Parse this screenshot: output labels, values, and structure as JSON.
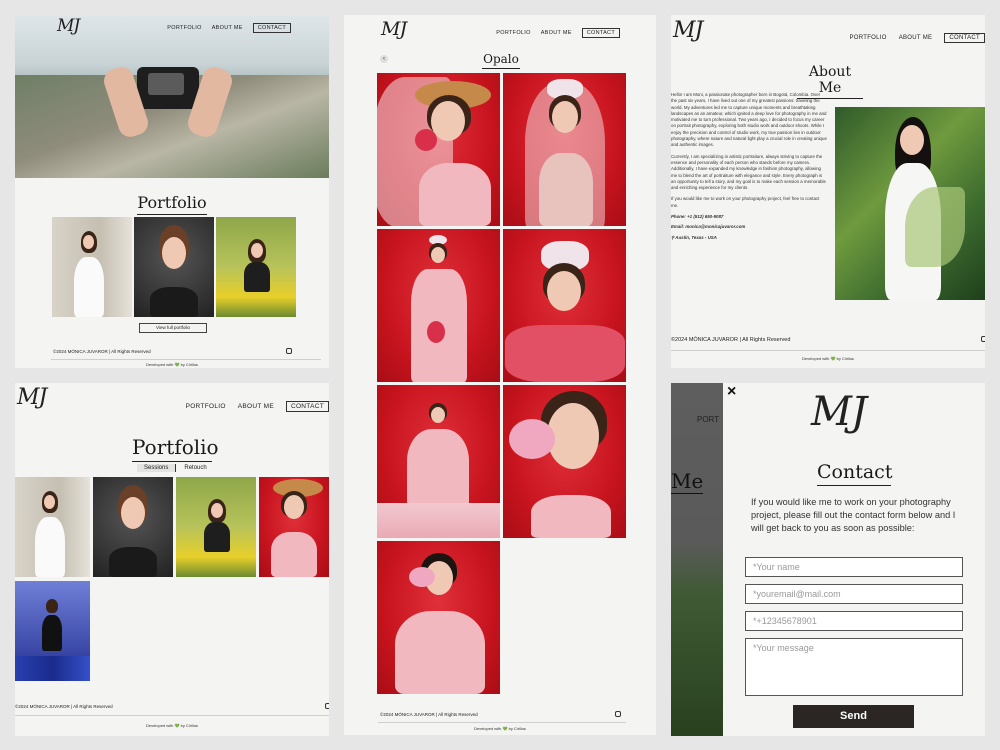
{
  "brand": {
    "logo": "MJ"
  },
  "nav": {
    "portfolio": "PORTFOLIO",
    "about": "ABOUT ME",
    "contact": "CONTACT"
  },
  "panel1": {
    "title": "Portfolio",
    "view_button": "View full portfolio",
    "footer": "©2024 MÓNICA JUVAROR | All Rights Reserved",
    "developed": "Developed with 💚 by Cirillus"
  },
  "panel2": {
    "title": "Portfolio",
    "tabs": [
      "Sessions",
      "Retouch"
    ],
    "footer": "©2024 MÓNICA JUVAROR | All Rights Reserved",
    "developed": "Developed with 💚 by Cirillus"
  },
  "panel3": {
    "back": "‹",
    "title": "Opalo",
    "footer": "©2024 MÓNICA JUVAROR | All Rights Reserved",
    "developed": "Developed with 💚 by Cirillus"
  },
  "panel4": {
    "title": "About Me",
    "para1": "Hello! I am Moni, a passionate photographer born in Bogotá, Colombia. Over the past six years, I have lived out one of my greatest passions: traveling the world. My adventures led me to capture unique moments and breathtaking landscapes as an amateur, which ignited a deep love for photography in me and motivated me to turn professional. Two years ago, I decided to focus my career on portrait photography, exploring both studio work and outdoor shoots. While I enjoy the precision and control of studio work, my true passion lies in outdoor photography, where nature and natural light play a crucial role in creating unique and authentic images.",
    "para2": "Currently, I am specializing in artistic portraiture, always striving to capture the essence and personality of each person who stands before my camera. Additionally, I have expanded my knowledge in fashion photography, allowing me to blend the art of portraiture with elegance and style. Every photograph is an opportunity to tell a story, and my goal is to make each session a memorable and enriching experience for my clients.",
    "para3": "If you would like me to work on your photography project, feel free to contact me.",
    "phone": "Phone: +1 (512) 650-9087",
    "email": "Email: monica@monicajuvaror.com",
    "location": "Austin, Texas - USA",
    "footer": "©2024 MÓNICA JUVAROR | All Rights Reserved",
    "developed": "Developed with 💚 by Cirillus"
  },
  "panel5": {
    "close": "×",
    "behind_nav": "PORT",
    "behind_heading": "Me",
    "title": "Contact",
    "intro": "If you would like me to work on your photography project, please fill out the contact form below and I will get back to you as soon as possible:",
    "name_placeholder": "*Your name",
    "email_placeholder": "*youremail@mail.com",
    "phone_placeholder": "*+12345678901",
    "message_placeholder": "*Your message",
    "send": "Send"
  },
  "colors": {
    "accent_red": "#c8141e",
    "dark_button": "#2b2624",
    "panel_bg": "#f4f4f2"
  }
}
